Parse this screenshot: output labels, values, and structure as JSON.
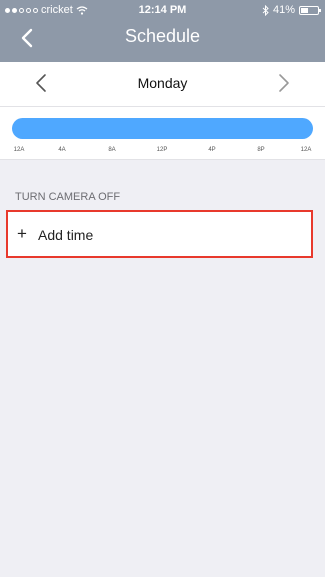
{
  "status_bar": {
    "carrier": "cricket",
    "time": "12:14 PM",
    "battery": "41%",
    "battery_level": 0.41
  },
  "nav": {
    "title": "Schedule",
    "back_icon": "chevron-left-icon"
  },
  "day_selector": {
    "day": "Monday",
    "prev_icon": "chevron-left-icon",
    "next_icon": "chevron-right-icon"
  },
  "timeline": {
    "ticks": [
      "12A",
      "4A",
      "8A",
      "12P",
      "4P",
      "8P",
      "12A"
    ],
    "bar_color": "#4fa8ff"
  },
  "section": {
    "header": "TURN CAMERA OFF",
    "add_icon": "plus-icon",
    "add_label": "Add time",
    "highlight_color": "#e8392c"
  }
}
